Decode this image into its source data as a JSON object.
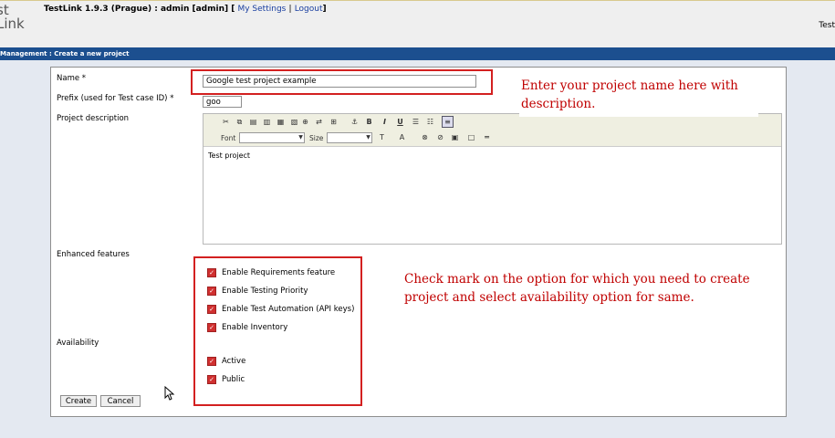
{
  "header": {
    "logo_line1": "st",
    "logo_line2": "Link",
    "app_info": "TestLink 1.9.3 (Prague) : admin [admin] [",
    "my_settings": "My Settings",
    "separator": "|",
    "logout": "Logout",
    "bracket_close": "]",
    "right_text": "Test"
  },
  "titlebar": {
    "text": "Management : Create a new project"
  },
  "form": {
    "name_label": "Name *",
    "name_value": "Google test project example",
    "prefix_label": "Prefix (used for Test case ID) *",
    "prefix_value": "goo",
    "description_label": "Project description",
    "editor": {
      "font_label": "Font",
      "size_label": "Size",
      "content": "Test project"
    },
    "enhanced_label": "Enhanced features",
    "features": [
      "Enable Requirements feature",
      "Enable Testing Priority",
      "Enable Test Automation (API keys)",
      "Enable Inventory"
    ],
    "availability_label": "Availability",
    "availability": [
      "Active",
      "Public"
    ],
    "create_button": "Create",
    "cancel_button": "Cancel"
  },
  "annotations": {
    "note1": "Enter  your project name here with description.",
    "note2": "Check mark on the option for which you need to create project and select availability option for same."
  },
  "colors": {
    "accent": "#1c4f8f",
    "annotation": "#c00000",
    "highlight_box": "#d32020"
  }
}
